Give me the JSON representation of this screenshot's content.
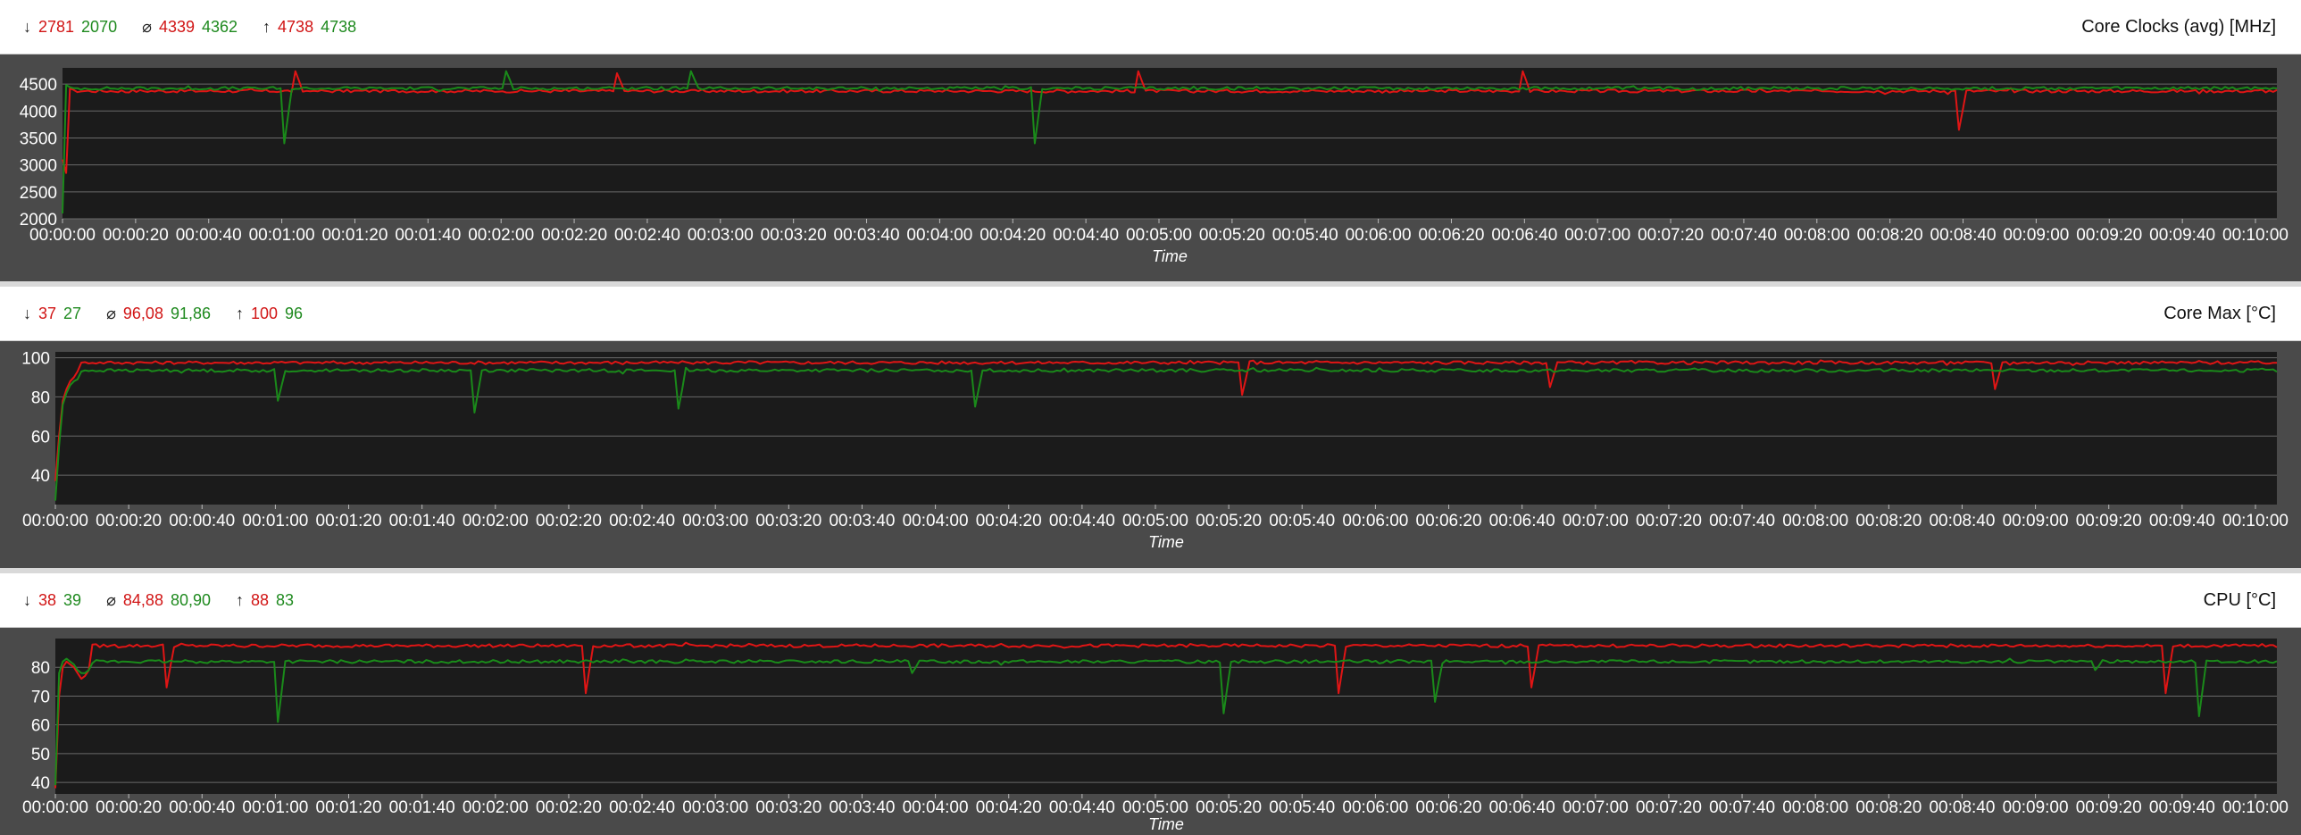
{
  "colors": {
    "red": "#e01515",
    "green": "#1a8a1a",
    "plot_bg": "#1b1b1b",
    "grid": "#6a6a6a"
  },
  "chart_data": [
    {
      "type": "line",
      "title": "Core Clocks (avg) [MHz]",
      "xlabel": "Time",
      "ylabel": "",
      "ylim": [
        2000,
        4800
      ],
      "yticks": [
        "2000",
        "2500",
        "3000",
        "3500",
        "4000",
        "4500"
      ],
      "xticks": [
        "00:00:00",
        "00:00:20",
        "00:00:40",
        "00:01:00",
        "00:01:20",
        "00:01:40",
        "00:02:00",
        "00:02:20",
        "00:02:40",
        "00:03:00",
        "00:03:20",
        "00:03:40",
        "00:04:00",
        "00:04:20",
        "00:04:40",
        "00:05:00",
        "00:05:20",
        "00:05:40",
        "00:06:00",
        "00:06:20",
        "00:06:40",
        "00:07:00",
        "00:07:20",
        "00:07:40",
        "00:08:00",
        "00:08:20",
        "00:08:40",
        "00:09:00",
        "00:09:20",
        "00:09:40",
        "00:10:00"
      ],
      "stats": {
        "min": [
          "2781",
          "2070"
        ],
        "avg": [
          "4339",
          "4362"
        ],
        "max": [
          "4738",
          "4738"
        ]
      },
      "series": [
        {
          "color": "red",
          "base": 4370,
          "start": [
            3100,
            2850,
            4420
          ],
          "dips": [
            [
              63,
              4738
            ],
            [
              291,
              4738
            ],
            [
              513,
              3650
            ],
            [
              395,
              4738
            ],
            [
              150,
              4700
            ]
          ]
        },
        {
          "color": "green",
          "base": 4420,
          "start": [
            2100,
            4480
          ],
          "dips": [
            [
              60,
              3400
            ],
            [
              120,
              4738
            ],
            [
              170,
              4738
            ],
            [
              263,
              3400
            ],
            [
              150,
              4420
            ]
          ]
        }
      ]
    },
    {
      "type": "line",
      "title": "Core Max [°C]",
      "xlabel": "Time",
      "ylabel": "",
      "ylim": [
        25,
        103
      ],
      "yticks": [
        "40",
        "60",
        "80",
        "100"
      ],
      "xticks": [
        "00:00:00",
        "00:00:20",
        "00:00:40",
        "00:01:00",
        "00:01:20",
        "00:01:40",
        "00:02:00",
        "00:02:20",
        "00:02:40",
        "00:03:00",
        "00:03:20",
        "00:03:40",
        "00:04:00",
        "00:04:20",
        "00:04:40",
        "00:05:00",
        "00:05:20",
        "00:05:40",
        "00:06:00",
        "00:06:20",
        "00:06:40",
        "00:07:00",
        "00:07:20",
        "00:07:40",
        "00:08:00",
        "00:08:20",
        "00:08:40",
        "00:09:00",
        "00:09:20",
        "00:09:40",
        "00:10:00"
      ],
      "stats": {
        "min": [
          "37",
          "27"
        ],
        "avg": [
          "96,08",
          "91,86"
        ],
        "max": [
          "100",
          "96"
        ]
      },
      "series": [
        {
          "color": "red",
          "base": 97.5,
          "start": [
            37,
            60,
            78,
            84,
            88,
            90,
            93
          ],
          "dips": [
            [
              320,
              81
            ],
            [
              403,
              85
            ],
            [
              523,
              84
            ]
          ]
        },
        {
          "color": "green",
          "base": 93.5,
          "start": [
            27,
            55,
            76,
            82,
            86,
            88,
            89
          ],
          "dips": [
            [
              60,
              78
            ],
            [
              113,
              72
            ],
            [
              168,
              74
            ],
            [
              248,
              75
            ]
          ]
        }
      ]
    },
    {
      "type": "line",
      "title": "CPU [°C]",
      "xlabel": "Time",
      "ylabel": "",
      "ylim": [
        36,
        90
      ],
      "yticks": [
        "40",
        "50",
        "60",
        "70",
        "80"
      ],
      "xticks": [
        "00:00:00",
        "00:00:20",
        "00:00:40",
        "00:01:00",
        "00:01:20",
        "00:01:40",
        "00:02:00",
        "00:02:20",
        "00:02:40",
        "00:03:00",
        "00:03:20",
        "00:03:40",
        "00:04:00",
        "00:04:20",
        "00:04:40",
        "00:05:00",
        "00:05:20",
        "00:05:40",
        "00:06:00",
        "00:06:20",
        "00:06:40",
        "00:07:00",
        "00:07:20",
        "00:07:40",
        "00:08:00",
        "00:08:20",
        "00:08:40",
        "00:09:00",
        "00:09:20",
        "00:09:40",
        "00:10:00"
      ],
      "stats": {
        "min": [
          "38",
          "39"
        ],
        "avg": [
          "84,88",
          "80,90"
        ],
        "max": [
          "88",
          "83"
        ]
      },
      "series": [
        {
          "color": "red",
          "base": 87.5,
          "start": [
            38,
            70,
            80,
            82,
            81,
            80,
            78,
            76,
            77,
            79
          ],
          "dips": [
            [
              30,
              73
            ],
            [
              143,
              71
            ],
            [
              346,
              71
            ],
            [
              398,
              73
            ],
            [
              569,
              71
            ]
          ]
        },
        {
          "color": "green",
          "base": 82,
          "start": [
            39,
            78,
            82,
            83,
            82,
            81,
            79,
            78,
            78,
            79
          ],
          "dips": [
            [
              60,
              61
            ],
            [
              231,
              78
            ],
            [
              315,
              64
            ],
            [
              372,
              68
            ],
            [
              550,
              79
            ],
            [
              578,
              63
            ]
          ]
        }
      ]
    }
  ]
}
